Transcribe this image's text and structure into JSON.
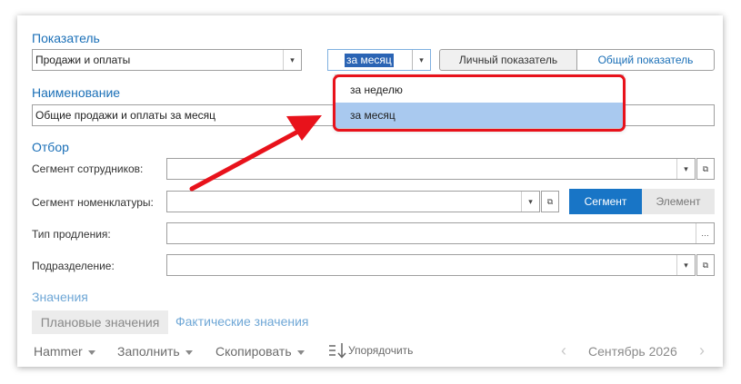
{
  "indicator": {
    "title": "Показатель",
    "value": "Продажи и оплаты",
    "period_value": "за месяц",
    "personal_button": "Личный показатель",
    "common_button": "Общий показатель"
  },
  "period_dropdown": {
    "options": [
      "за неделю",
      "за месяц"
    ],
    "selected_index": 1
  },
  "name": {
    "title": "Наименование",
    "value": "Общие продажи и оплаты за месяц"
  },
  "filter": {
    "title": "Отбор",
    "employee_segment_label": "Сегмент сотрудников:",
    "nomenclature_segment_label": "Сегмент номенклатуры:",
    "segment_button": "Сегмент",
    "element_button": "Элемент",
    "extension_type_label": "Тип продления:",
    "department_label": "Подразделение:"
  },
  "values": {
    "title": "Значения",
    "planned_tab": "Плановые значения",
    "actual_tab": "Фактические значения"
  },
  "toolbar": {
    "hammer": "Hammer",
    "fill": "Заполнить",
    "copy": "Скопировать",
    "sort": "Упорядочить",
    "month": "Сентябрь 2026"
  },
  "colors": {
    "accent": "#1a6fb7",
    "highlight": "#a9c9ef",
    "annotation_red": "#e8121b",
    "segment_active": "#1875c6"
  },
  "icons": [
    "dropdown-arrow-icon",
    "open-form-icon",
    "ellipsis-icon",
    "sort-icon",
    "chevron-left-icon",
    "chevron-right-icon",
    "annotation-arrow-icon"
  ]
}
